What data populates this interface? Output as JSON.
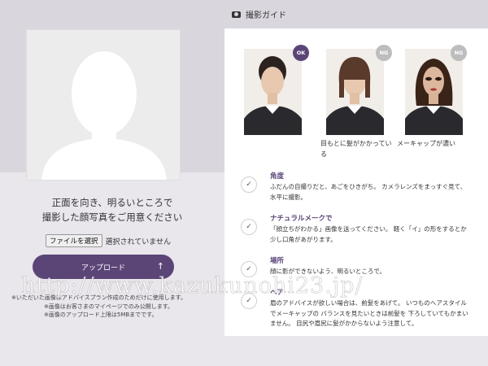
{
  "upload": {
    "prompt_line1": "正面を向き、明るいところで",
    "prompt_line2": "撮影した顔写真をご用意ください",
    "file_button": "ファイルを選択",
    "file_status": "選択されていません",
    "upload_label": "アップロード",
    "notes": [
      "※いただいた画像はアドバイスプラン作成のためだけに使用します。",
      "※画像はお客さまのマイページでのみ公開します。",
      "※画像のアップロード上限は5MBまでです。"
    ]
  },
  "guide": {
    "title": "撮影ガイド",
    "photos": [
      {
        "badge": "OK",
        "caption": ""
      },
      {
        "badge": "NG",
        "caption": "目もとに髪がかかってい る"
      },
      {
        "badge": "NG",
        "caption": "メーキャップが濃い"
      }
    ],
    "items": [
      {
        "title": "角度",
        "desc": "ふだんの自撮りだと、あごをひきがち。 カメラレンズをまっすぐ見て、水平に撮影。"
      },
      {
        "title": "ナチュラルメークで",
        "desc": "「顔立ちがわかる」画像を送ってください。 軽く「イ」の形をするとか少し口角があがります。"
      },
      {
        "title": "場所",
        "desc": "顔に影ができないよう、明るいところで。"
      },
      {
        "title": "ヘア",
        "desc": "眉のアドバイスが欲しい場合は、前髪をあげて。 いつものヘアスタイルでメーキャップの バランスを見たいときは前髪を 下ろしていてもかまいません。 目尻や眉尻に髪がかからないよう注意して。"
      }
    ]
  },
  "watermark": "http://www.kazukunohi23.jp/",
  "colors": {
    "accent": "#5b4577",
    "ng": "#bdbdbd"
  }
}
